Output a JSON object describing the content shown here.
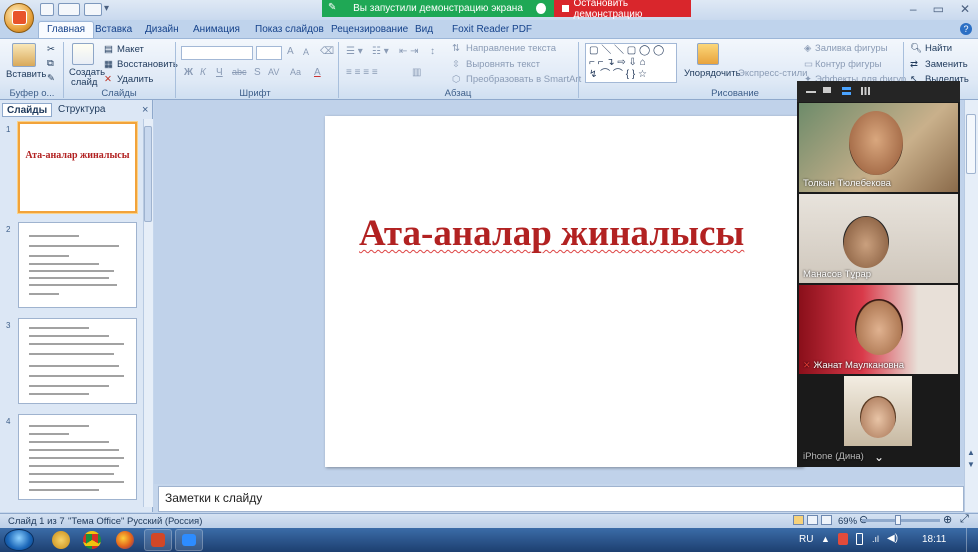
{
  "window": {
    "minimize": "–",
    "restore": "▭",
    "close": "✕"
  },
  "share": {
    "status": "Вы запустили демонстрацию экрана",
    "stop": "Остановить демонстрацию"
  },
  "tabs": [
    {
      "label": "Главная",
      "active": true
    },
    {
      "label": "Вставка"
    },
    {
      "label": "Дизайн"
    },
    {
      "label": "Анимация"
    },
    {
      "label": "Показ слайдов"
    },
    {
      "label": "Рецензирование"
    },
    {
      "label": "Вид"
    },
    {
      "label": "Foxit Reader PDF"
    }
  ],
  "ribbon": {
    "clipboard": {
      "paste": "Вставить",
      "label": "Буфер о..."
    },
    "slides": {
      "create": "Создать",
      "create2": "слайд",
      "layout": "Макет",
      "reset": "Восстановить",
      "delete": "Удалить",
      "label": "Слайды"
    },
    "font": {
      "bold": "Ж",
      "italic": "К",
      "underline": "Ч",
      "strike": "abc",
      "shadow": "S",
      "spacing": "AV",
      "case": "Aa",
      "grow": "A",
      "shrink": "A",
      "color": "A",
      "label": "Шрифт"
    },
    "paragraph": {
      "direction": "Направление текста",
      "align": "Выровнять текст",
      "smartart": "Преобразовать в SmartArt",
      "label": "Абзац"
    },
    "drawing": {
      "arrange": "Упорядочить",
      "styles": "Экспресс-стили",
      "fill": "Заливка фигуры",
      "outline": "Контур фигуры",
      "effects": "Эффекты для фигур",
      "label": "Рисование"
    },
    "editing": {
      "find": "Найти",
      "replace": "Заменить",
      "select": "Выделить",
      "label": "ние"
    }
  },
  "panel": {
    "tab_slides": "Слайды",
    "tab_outline": "Структура",
    "close": "×",
    "thumbs": [
      {
        "num": "1",
        "title": "Ата-аналар жиналысы"
      },
      {
        "num": "2"
      },
      {
        "num": "3"
      },
      {
        "num": "4"
      }
    ]
  },
  "slide": {
    "title": "Ата-аналар жиналысы"
  },
  "notes": {
    "placeholder": "Заметки к слайду"
  },
  "video": {
    "participants": [
      {
        "name": "Толкын Тюлебекова"
      },
      {
        "name": "Манасов Тұрар"
      },
      {
        "name": "Жанат Маулкановна",
        "muted": true
      },
      {
        "name": "iPhone (Дина)"
      }
    ]
  },
  "status": {
    "slide": "Слайд 1 из 7",
    "theme": "\"Тема Office\"",
    "lang": "Русский (Россия)",
    "zoom": "69%",
    "zoom_fraction": 0.43
  },
  "taskbar": {
    "lang": "RU",
    "time": "18:11"
  },
  "colors": {
    "accent": "#b22222",
    "share_green": "#1fa855",
    "share_red": "#d9262c",
    "ribbon": "#dfe9f6"
  }
}
